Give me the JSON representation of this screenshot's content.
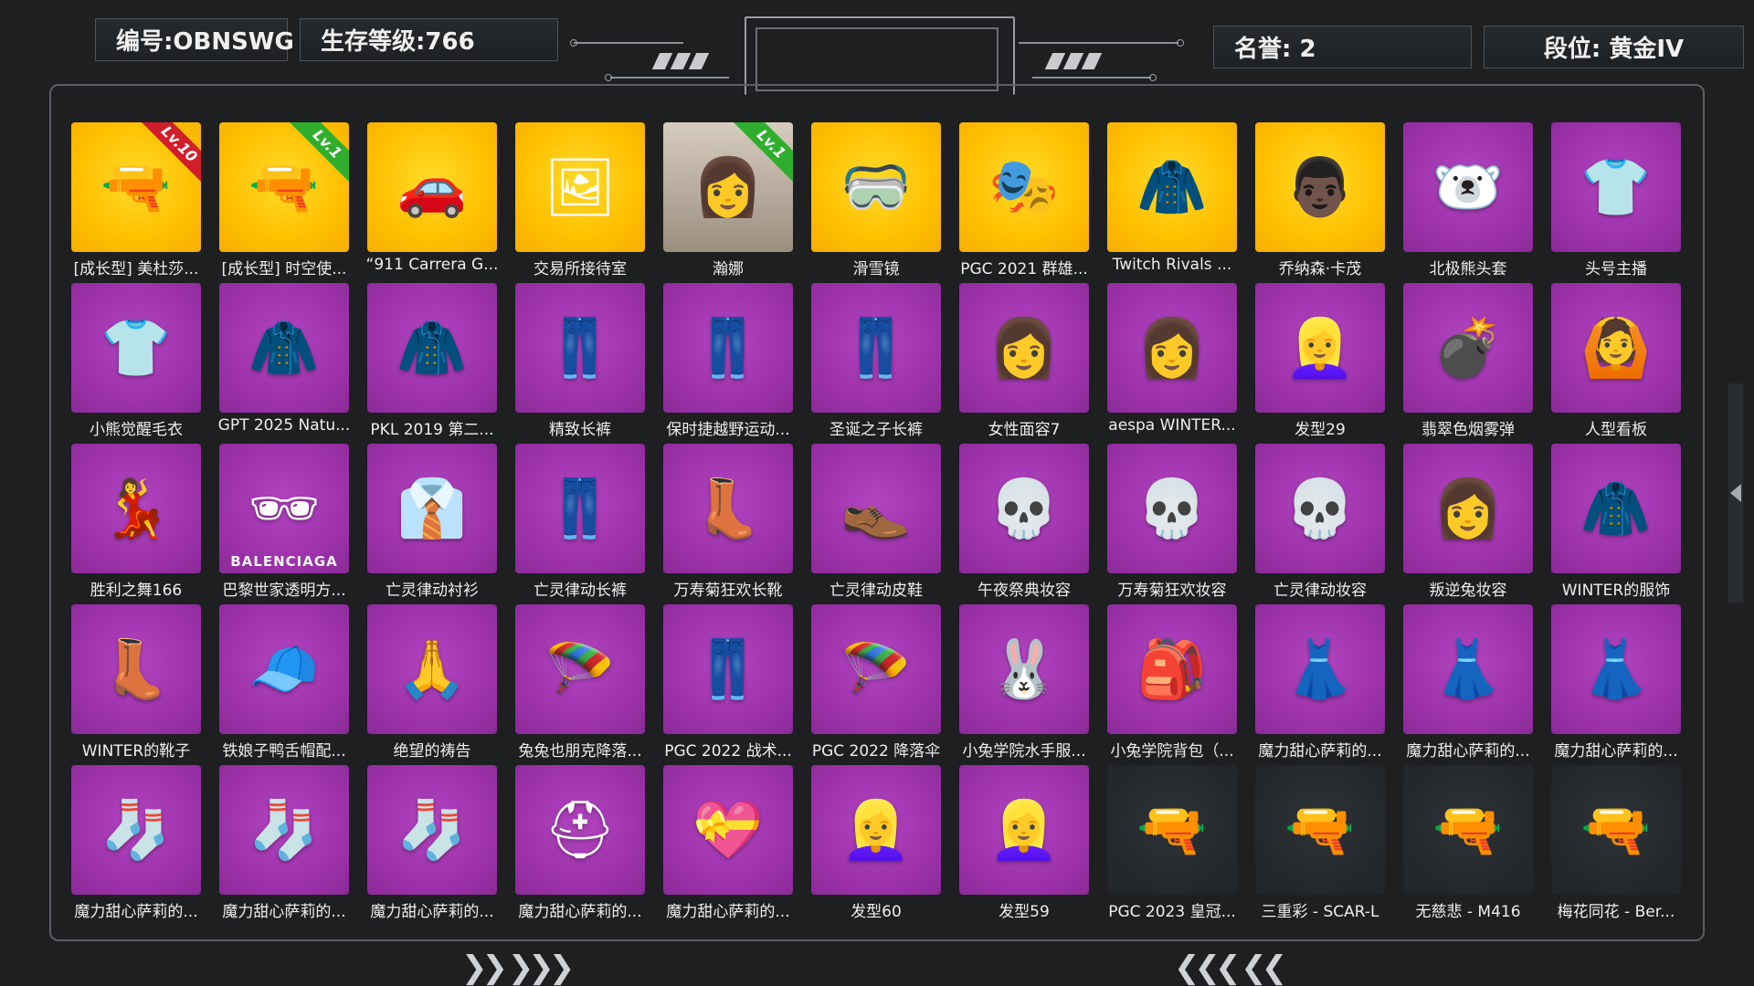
{
  "header": {
    "id_label": "编号:OBNSWG",
    "level_label": "生存等级:766",
    "honor_label": "名誉: 2",
    "rank_label": "段位: 黄金IV"
  },
  "colors": {
    "purple": "#9a30a8",
    "gold": "#ffc000",
    "dark": "#22262a",
    "background": "#1d1f21",
    "lv_red": "#d11e2a",
    "lv_green": "#2fae2d"
  },
  "nav": {
    "left_arrows": "❯❯ ❯❯❯",
    "right_arrows": "❮❮❮ ❮❮"
  },
  "items": [
    {
      "label": "[成长型] 美杜莎...",
      "bg": "gold",
      "icon": "rifle-icon",
      "glyph": "🔫",
      "lv": "Lv.10",
      "lv_color": "red"
    },
    {
      "label": "[成长型] 时空使...",
      "bg": "gold",
      "icon": "rifle-icon",
      "glyph": "🔫",
      "lv": "Lv.1",
      "lv_color": "green"
    },
    {
      "label": "“911 Carrera G...",
      "bg": "gold",
      "icon": "car-icon",
      "glyph": "🚗"
    },
    {
      "label": "交易所接待室",
      "bg": "gold",
      "icon": "room-icon",
      "glyph": "🖼"
    },
    {
      "label": "瀚娜",
      "bg": "photo",
      "icon": "character-icon",
      "glyph": "👩",
      "lv": "Lv.1",
      "lv_color": "green"
    },
    {
      "label": "滑雪镜",
      "bg": "gold",
      "icon": "goggles-icon",
      "glyph": "🥽"
    },
    {
      "label": "PGC 2021 群雄...",
      "bg": "gold",
      "icon": "mask-icon",
      "glyph": "🎭"
    },
    {
      "label": "Twitch Rivals ...",
      "bg": "gold",
      "icon": "jacket-icon",
      "glyph": "🧥"
    },
    {
      "label": "乔纳森·卡茂",
      "bg": "gold",
      "icon": "face-icon",
      "glyph": "👨🏿"
    },
    {
      "label": "北极熊头套",
      "bg": "purple",
      "icon": "bear-head-icon",
      "glyph": "🐻‍❄️"
    },
    {
      "label": "头号主播",
      "bg": "purple",
      "icon": "tshirt-icon",
      "glyph": "👕"
    },
    {
      "label": "小熊觉醒毛衣",
      "bg": "purple",
      "icon": "sweater-icon",
      "glyph": "👕"
    },
    {
      "label": "GPT 2025 Natu...",
      "bg": "purple",
      "icon": "hoodie-icon",
      "glyph": "🧥"
    },
    {
      "label": "PKL 2019 第二...",
      "bg": "purple",
      "icon": "jacket-icon",
      "glyph": "🧥"
    },
    {
      "label": "精致长裤",
      "bg": "purple",
      "icon": "pants-icon",
      "glyph": "👖"
    },
    {
      "label": "保时捷越野运动...",
      "bg": "purple",
      "icon": "pants-icon",
      "glyph": "👖"
    },
    {
      "label": "圣诞之子长裤",
      "bg": "purple",
      "icon": "pants-icon",
      "glyph": "👖"
    },
    {
      "label": "女性面容7",
      "bg": "purple",
      "icon": "face-icon",
      "glyph": "👩"
    },
    {
      "label": "aespa WINTER...",
      "bg": "purple",
      "icon": "face-icon",
      "glyph": "👩"
    },
    {
      "label": "发型29",
      "bg": "purple",
      "icon": "hair-icon",
      "glyph": "👱‍♀️"
    },
    {
      "label": "翡翠色烟雾弹",
      "bg": "purple",
      "icon": "grenade-icon",
      "glyph": "💣"
    },
    {
      "label": "人型看板",
      "bg": "purple",
      "icon": "figure-icon",
      "glyph": "🙆"
    },
    {
      "label": "胜利之舞166",
      "bg": "purple",
      "icon": "dance-icon",
      "glyph": "💃"
    },
    {
      "label": "巴黎世家透明方...",
      "bg": "purple",
      "icon": "glasses-icon",
      "glyph": "🕶",
      "brand": "BALENCIAGA"
    },
    {
      "label": "亡灵律动衬衫",
      "bg": "purple",
      "icon": "shirt-icon",
      "glyph": "👔"
    },
    {
      "label": "亡灵律动长裤",
      "bg": "purple",
      "icon": "pants-icon",
      "glyph": "👖"
    },
    {
      "label": "万寿菊狂欢长靴",
      "bg": "purple",
      "icon": "boots-icon",
      "glyph": "👢"
    },
    {
      "label": "亡灵律动皮鞋",
      "bg": "purple",
      "icon": "shoes-icon",
      "glyph": "👞"
    },
    {
      "label": "午夜祭典妆容",
      "bg": "purple",
      "icon": "skull-face-icon",
      "glyph": "💀"
    },
    {
      "label": "万寿菊狂欢妆容",
      "bg": "purple",
      "icon": "skull-face-icon",
      "glyph": "💀"
    },
    {
      "label": "亡灵律动妆容",
      "bg": "purple",
      "icon": "skull-face-icon",
      "glyph": "💀"
    },
    {
      "label": "叛逆兔妆容",
      "bg": "purple",
      "icon": "face-icon",
      "glyph": "👩"
    },
    {
      "label": "WINTER的服饰",
      "bg": "purple",
      "icon": "jacket-icon",
      "glyph": "🧥"
    },
    {
      "label": "WINTER的靴子",
      "bg": "purple",
      "icon": "boots-icon",
      "glyph": "👢"
    },
    {
      "label": "铁娘子鸭舌帽配...",
      "bg": "purple",
      "icon": "cap-icon",
      "glyph": "🧢"
    },
    {
      "label": "绝望的祷告",
      "bg": "purple",
      "icon": "pray-icon",
      "glyph": "🙏"
    },
    {
      "label": "兔兔也朋克降落...",
      "bg": "purple",
      "icon": "parachute-icon",
      "glyph": "🪂"
    },
    {
      "label": "PGC 2022 战术...",
      "bg": "purple",
      "icon": "pants-icon",
      "glyph": "👖"
    },
    {
      "label": "PGC 2022 降落伞",
      "bg": "purple",
      "icon": "parachute-icon",
      "glyph": "🪂"
    },
    {
      "label": "小兔学院水手服...",
      "bg": "purple",
      "icon": "bunny-hat-icon",
      "glyph": "🐰"
    },
    {
      "label": "小兔学院背包（...",
      "bg": "purple",
      "icon": "backpack-icon",
      "glyph": "🎒"
    },
    {
      "label": "魔力甜心萨莉的...",
      "bg": "purple",
      "icon": "dress-icon",
      "glyph": "👗"
    },
    {
      "label": "魔力甜心萨莉的...",
      "bg": "purple",
      "icon": "dress-icon",
      "glyph": "👗"
    },
    {
      "label": "魔力甜心萨莉的...",
      "bg": "purple",
      "icon": "dress-icon",
      "glyph": "👗"
    },
    {
      "label": "魔力甜心萨莉的...",
      "bg": "purple",
      "icon": "stocking-icon",
      "glyph": "🧦"
    },
    {
      "label": "魔力甜心萨莉的...",
      "bg": "purple",
      "icon": "stocking-icon",
      "glyph": "🧦"
    },
    {
      "label": "魔力甜心萨莉的...",
      "bg": "purple",
      "icon": "stocking-icon",
      "glyph": "🧦"
    },
    {
      "label": "魔力甜心萨莉的...",
      "bg": "purple",
      "icon": "helmet-icon",
      "glyph": "⛑"
    },
    {
      "label": "魔力甜心萨莉的...",
      "bg": "purple",
      "icon": "heart-backpack-icon",
      "glyph": "💝"
    },
    {
      "label": "发型60",
      "bg": "purple",
      "icon": "hair-icon",
      "glyph": "👱‍♀️"
    },
    {
      "label": "发型59",
      "bg": "purple",
      "icon": "hair-icon",
      "glyph": "👱‍♀️"
    },
    {
      "label": "PGC 2023 皇冠...",
      "bg": "dark",
      "icon": "rifle-icon",
      "glyph": "🔫"
    },
    {
      "label": "三重彩 - SCAR-L",
      "bg": "dark",
      "icon": "rifle-icon",
      "glyph": "🔫"
    },
    {
      "label": "无慈悲 - M416",
      "bg": "dark",
      "icon": "rifle-icon",
      "glyph": "🔫"
    },
    {
      "label": "梅花同花 - Ber...",
      "bg": "dark",
      "icon": "rifle-icon",
      "glyph": "🔫"
    }
  ]
}
